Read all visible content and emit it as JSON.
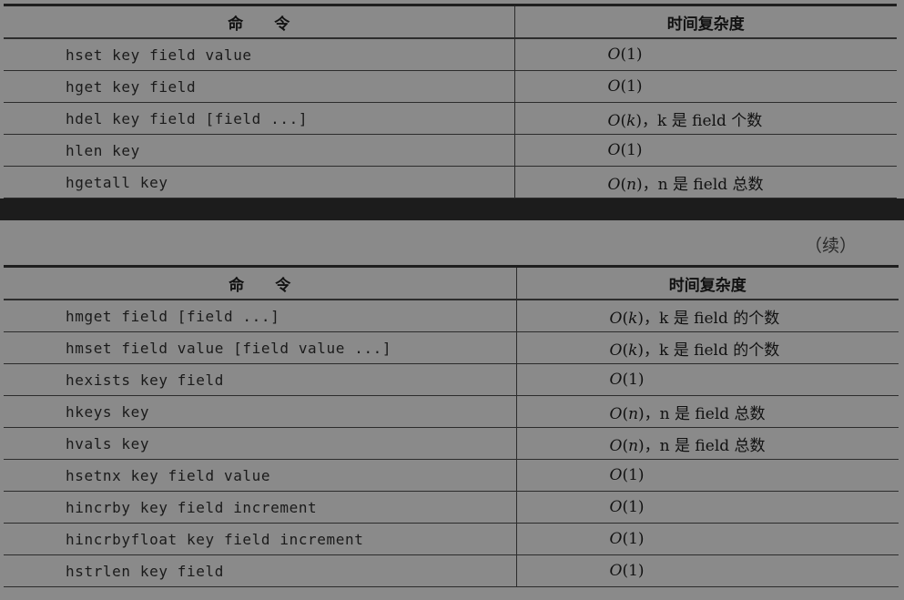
{
  "table1": {
    "header": {
      "command": "命　　令",
      "complexity": "时间复杂度"
    },
    "rows": [
      {
        "cmd": "hset key field value",
        "o": "O",
        "arg": "1",
        "note": ""
      },
      {
        "cmd": "hget key field",
        "o": "O",
        "arg": "1",
        "note": ""
      },
      {
        "cmd": "hdel key field [field ...]",
        "o": "O",
        "arg": "k",
        "note": "，k 是 field 个数"
      },
      {
        "cmd": "hlen key",
        "o": "O",
        "arg": "1",
        "note": ""
      },
      {
        "cmd": "hgetall key",
        "o": "O",
        "arg": "n",
        "note": "，n 是 field 总数"
      }
    ]
  },
  "continued_label": "（续）",
  "table2": {
    "header": {
      "command": "命　　令",
      "complexity": "时间复杂度"
    },
    "rows": [
      {
        "cmd": "hmget field [field ...]",
        "o": "O",
        "arg": "k",
        "note": "，k 是 field 的个数"
      },
      {
        "cmd": "hmset field value [field value ...]",
        "o": "O",
        "arg": "k",
        "note": "，k 是 field 的个数"
      },
      {
        "cmd": "hexists key field",
        "o": "O",
        "arg": "1",
        "note": ""
      },
      {
        "cmd": "hkeys key",
        "o": "O",
        "arg": "n",
        "note": "，n 是 field 总数"
      },
      {
        "cmd": "hvals key",
        "o": "O",
        "arg": "n",
        "note": "，n 是 field 总数"
      },
      {
        "cmd": "hsetnx key field value",
        "o": "O",
        "arg": "1",
        "note": ""
      },
      {
        "cmd": "hincrby key field increment",
        "o": "O",
        "arg": "1",
        "note": ""
      },
      {
        "cmd": "hincrbyfloat key field increment",
        "o": "O",
        "arg": "1",
        "note": ""
      },
      {
        "cmd": "hstrlen key field",
        "o": "O",
        "arg": "1",
        "note": ""
      }
    ]
  }
}
